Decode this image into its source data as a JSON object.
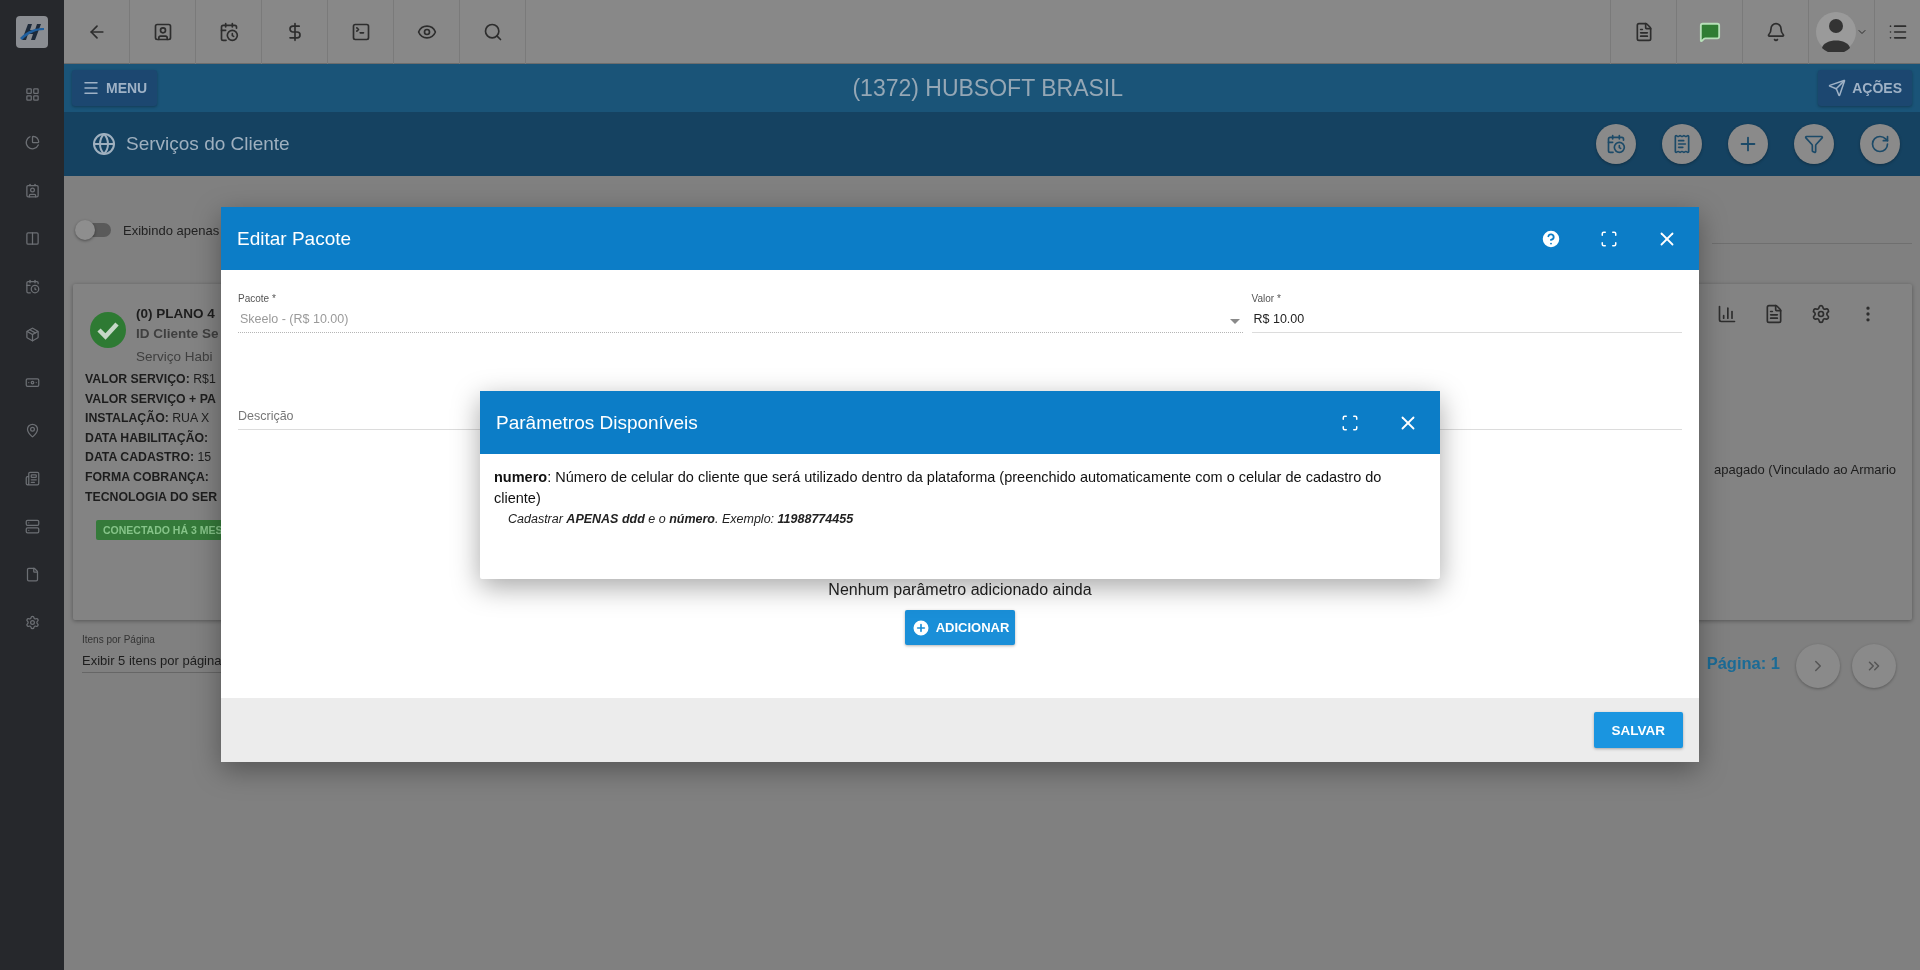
{
  "header": {
    "menu_button": "MENU",
    "title": "(1372) HUBSOFT BRASIL",
    "actions_button": "AÇÕES"
  },
  "page": {
    "title": "Serviços do Cliente",
    "filter_toggle": {
      "label": "Exibindo apenas",
      "on": false
    }
  },
  "service_card": {
    "title": "(0) PLANO 4",
    "client_id": "ID Cliente Se",
    "status": "Serviço Habi",
    "details": [
      "**VALOR SERVIÇO:** R$1",
      "**VALOR SERVIÇO + PA**",
      "**INSTALAÇÃO:** RUA X",
      "**DATA HABILITAÇÃO:**",
      "**DATA CADASTRO:** 15",
      "**FORMA COBRANÇA:**",
      "**TECNOLOGIA DO SER**"
    ],
    "badge": "CONECTADO HÁ 3 MES",
    "note": "apagado (Vinculado ao Armario"
  },
  "pagination": {
    "per_page_label": "Itens por Página",
    "per_page_value": "Exibir 5 itens por página",
    "page": "Página: 1"
  },
  "edit_dialog": {
    "title": "Editar Pacote",
    "fields": [
      {
        "kind": "select",
        "label": "Pacote *",
        "value": "Skeelo - (R$ 10.00)",
        "disabled": true
      },
      {
        "kind": "text",
        "label": "Valor *",
        "value": "R$ 10.00",
        "disabled": false
      },
      {
        "kind": "textarea",
        "placeholder": "Descrição"
      }
    ],
    "empty_message": "Nenhum parâmetro adicionado ainda",
    "add_button": "ADICIONAR",
    "save_button": "SALVAR"
  },
  "params_dialog": {
    "title": "Parâmetros Disponíveis",
    "params": [
      {
        "description": "**numero**: Número de celular do cliente que será utilizado dentro da plataforma (preenchido automaticamente com o celular de cadastro do cliente)",
        "hint": "Cadastrar **APENAS ddd** e o **número**. Exemplo: **11988774455**"
      }
    ]
  }
}
